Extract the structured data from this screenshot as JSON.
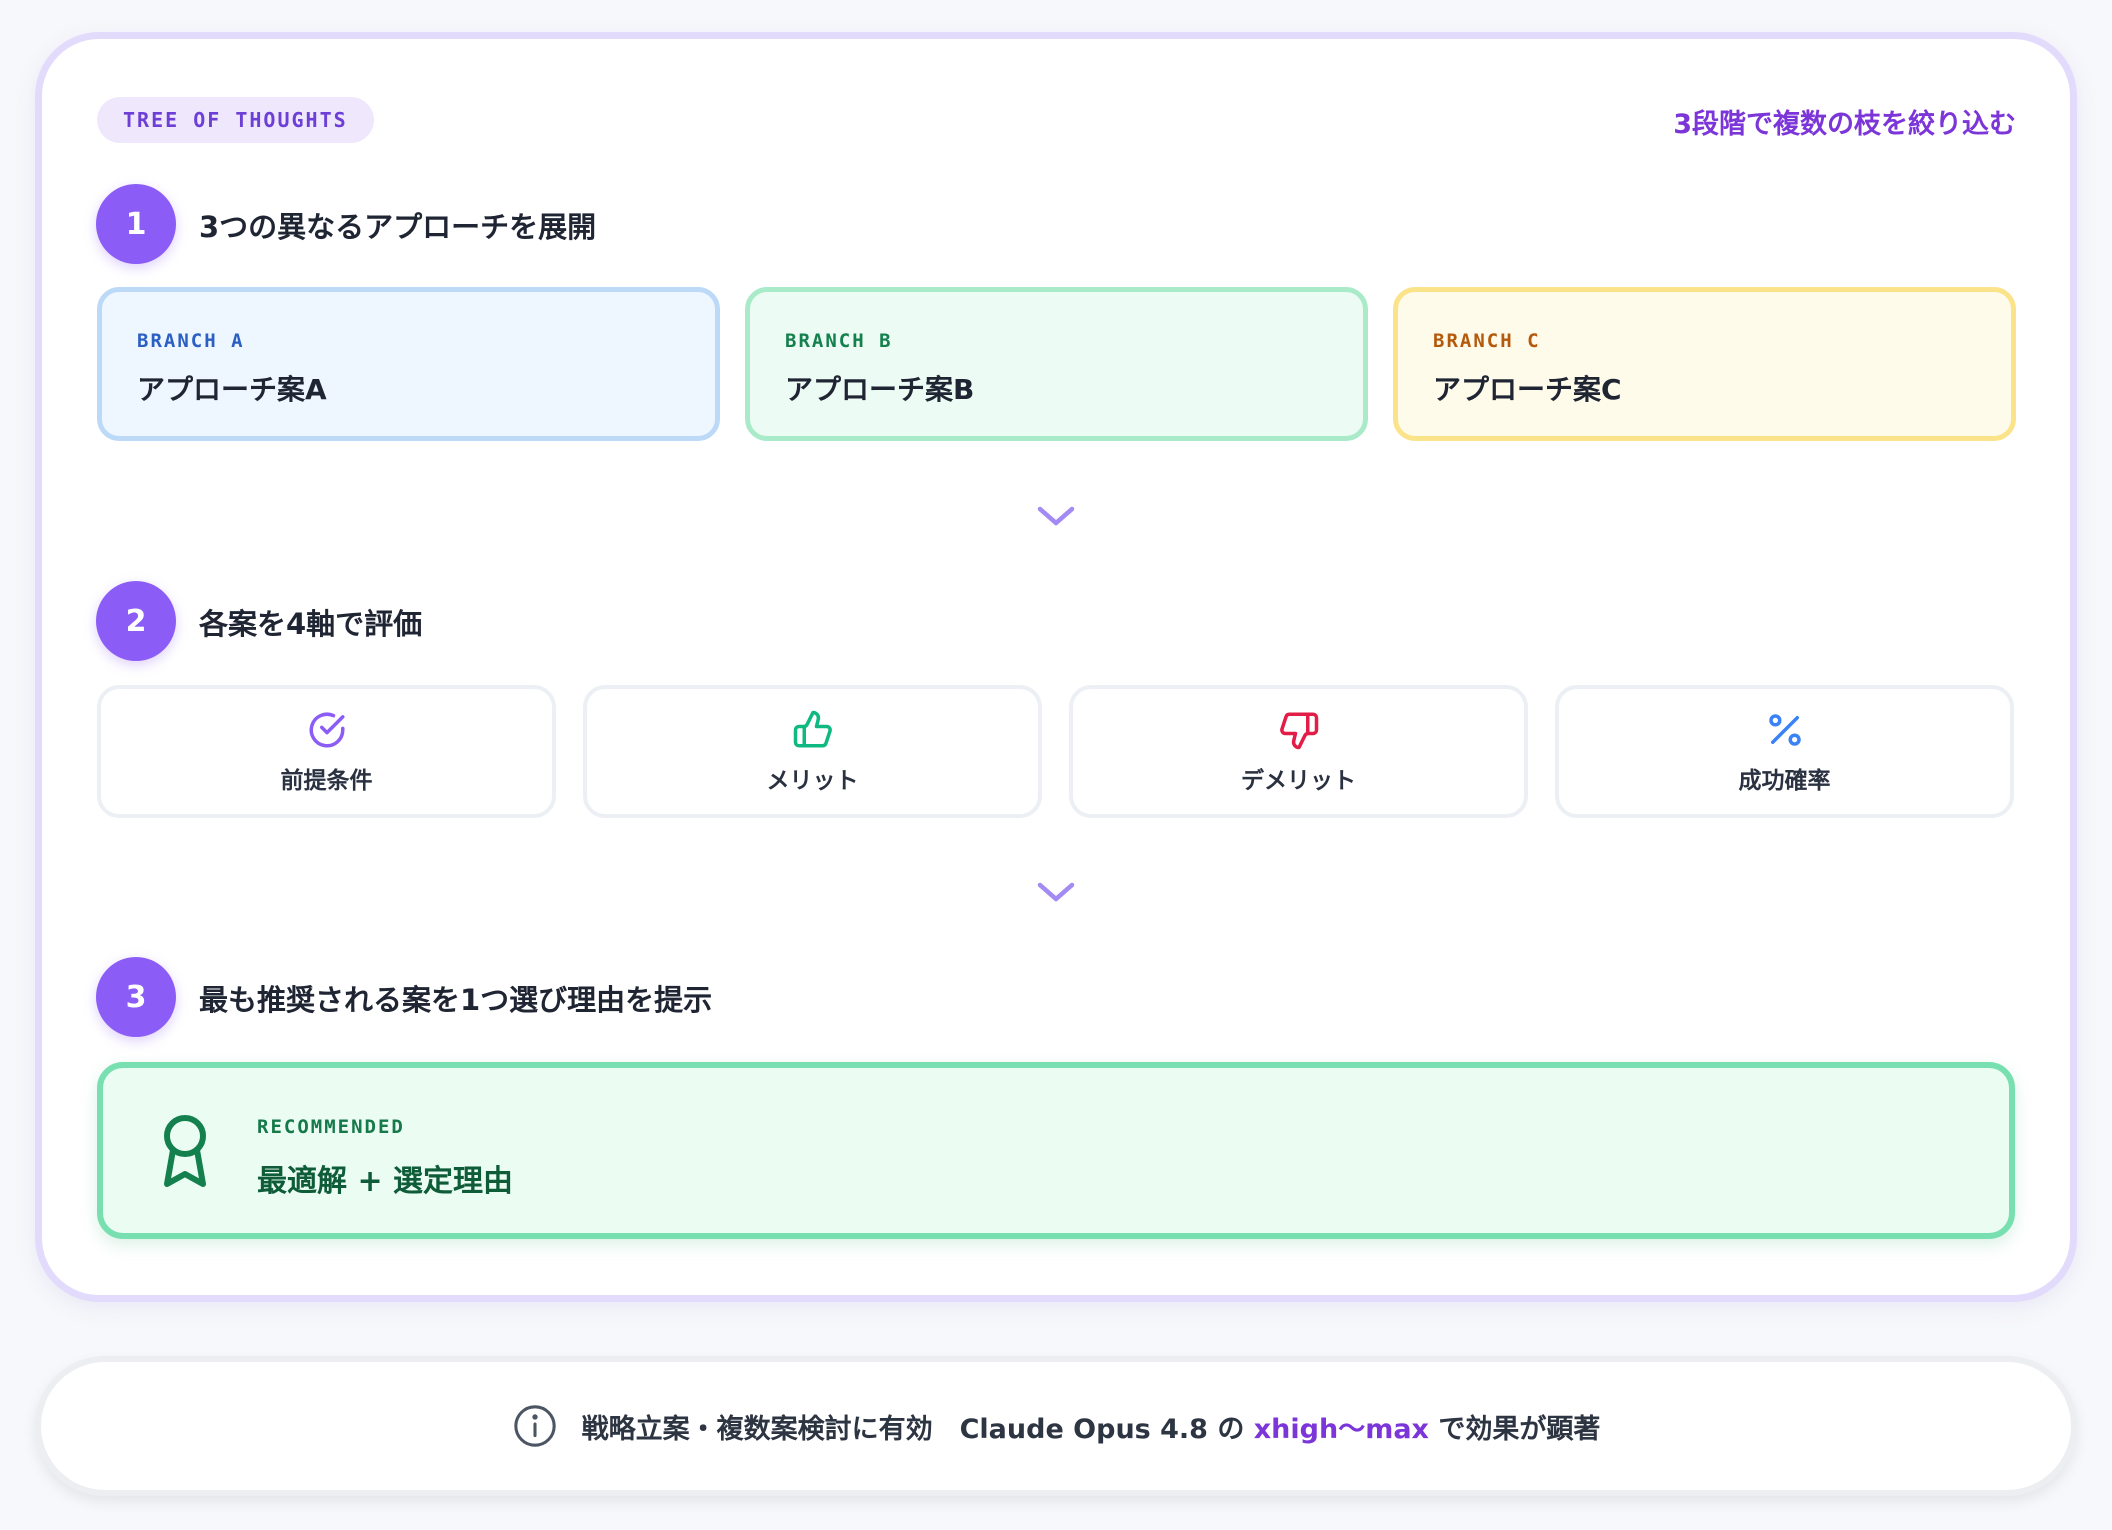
{
  "header": {
    "chip": "TREE OF THOUGHTS",
    "tagline": "3段階で複数の枝を絞り込む"
  },
  "steps": [
    {
      "number": "1",
      "title": "3つの異なるアプローチを展開"
    },
    {
      "number": "2",
      "title": "各案を4軸で評価"
    },
    {
      "number": "3",
      "title": "最も推奨される案を1つ選び理由を提示"
    }
  ],
  "branches": [
    {
      "tag": "BRANCH A",
      "label": "アプローチ案A",
      "color": "#2b5fc2"
    },
    {
      "tag": "BRANCH B",
      "label": "アプローチ案B",
      "color": "#14804e"
    },
    {
      "tag": "BRANCH C",
      "label": "アプローチ案C",
      "color": "#b45a0c"
    }
  ],
  "criteria": [
    {
      "icon": "check-circle-icon",
      "label": "前提条件",
      "color": "#8b5cf6"
    },
    {
      "icon": "thumbs-up-icon",
      "label": "メリット",
      "color": "#10b981"
    },
    {
      "icon": "thumbs-down-icon",
      "label": "デメリット",
      "color": "#e11d48"
    },
    {
      "icon": "percent-icon",
      "label": "成功確率",
      "color": "#3b82f6"
    }
  ],
  "recommended": {
    "icon": "award-ribbon-icon",
    "tag": "RECOMMENDED",
    "label": "最適解 + 選定理由"
  },
  "footer": {
    "icon": "info-circle-icon",
    "text_1": "戦略立案・複数案検討に有効　Claude Opus 4.8 の ",
    "highlight": "xhigh〜max",
    "text_2": " で効果が顕著"
  },
  "colors": {
    "accent": "#8b5cf6",
    "highlight_text": "#7b35d8"
  }
}
